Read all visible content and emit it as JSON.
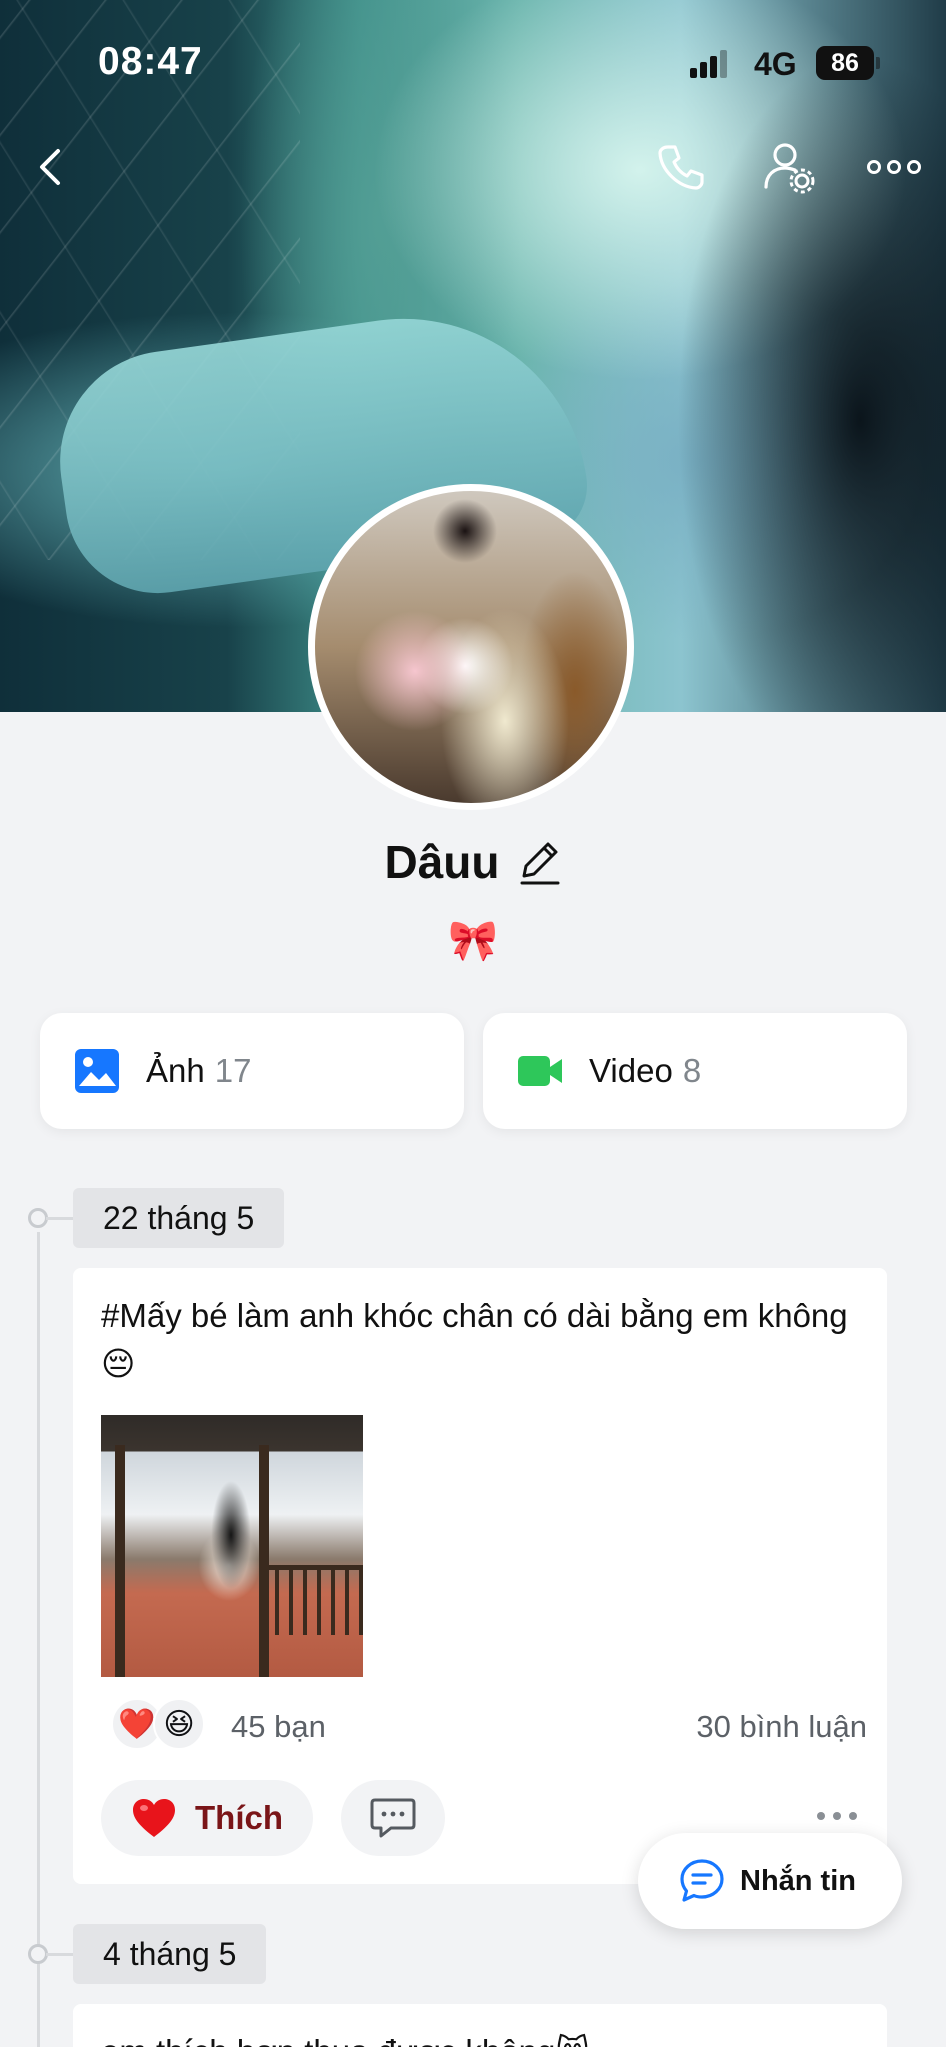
{
  "status_bar": {
    "time": "08:47",
    "network": "4G",
    "battery": "86"
  },
  "header": {
    "icons": [
      "back-icon",
      "phone-icon",
      "user-settings-icon",
      "more-icon"
    ]
  },
  "profile": {
    "name": "Dâuu",
    "bio_emoji": "🎀"
  },
  "media": [
    {
      "label": "Ảnh",
      "count": "17",
      "icon": "photo-icon",
      "color": "#1677ff"
    },
    {
      "label": "Video",
      "count": "8",
      "icon": "video-icon",
      "color": "#2ec75a"
    }
  ],
  "timeline": [
    {
      "date": "22 tháng 5",
      "post": {
        "text": "#Mấy bé làm anh khóc chân có dài bằng em không😔",
        "reaction_emojis": [
          "❤️",
          "😆"
        ],
        "reaction_count": "45 bạn",
        "comment_count": "30 bình luận",
        "like_label": "Thích"
      }
    },
    {
      "date": "4 tháng 5",
      "post": {
        "text": "em thích hơn thua được không😸"
      }
    }
  ],
  "chat_button": {
    "label": "Nhắn tin"
  },
  "colors": {
    "accent": "#1677ff",
    "like_text": "#7a1518",
    "heart": "#e8141b"
  }
}
